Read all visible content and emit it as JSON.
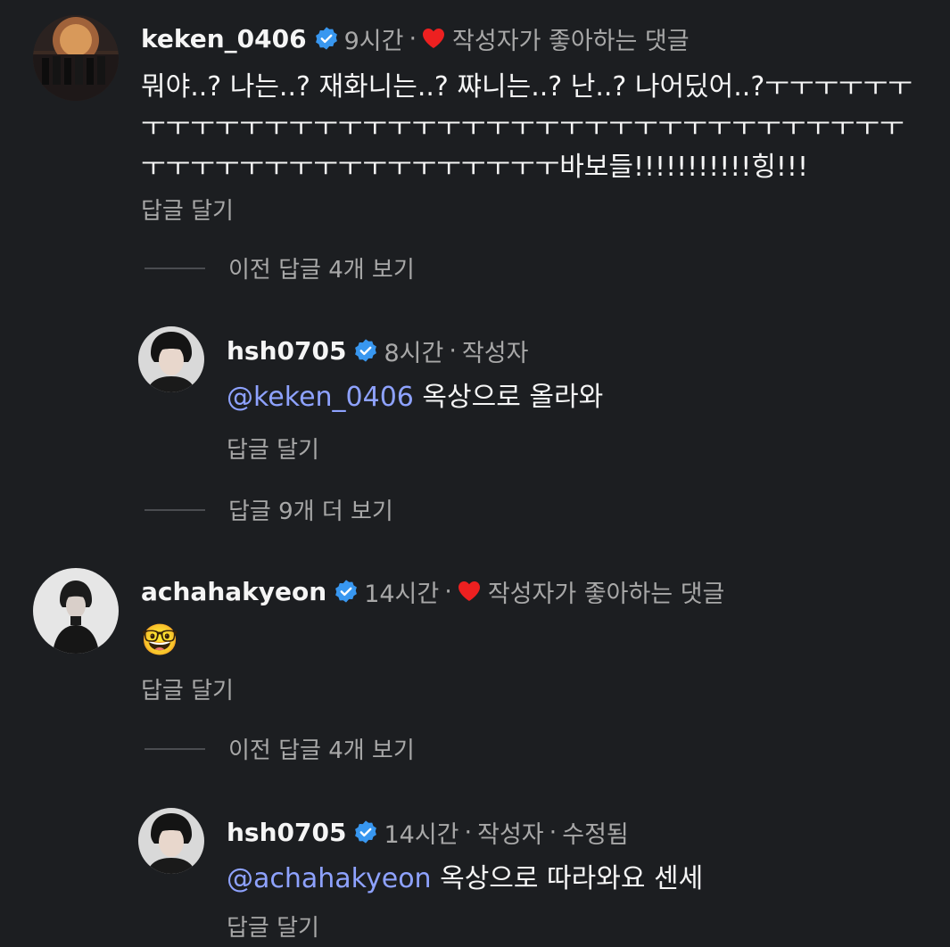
{
  "comments": [
    {
      "username": "keken_0406",
      "time": "9시간",
      "liked_by_author_label": "작성자가 좋아하는 댓글",
      "text": "뭐야..? 나는..? 재화니는..? 쨔니는..? 난..? 나어딨어..?ㅜㅜㅜㅜㅜㅜㅜㅜㅜㅜㅜㅜㅜㅜㅜㅜㅜㅜㅜㅜㅜㅜㅜㅜㅜㅜㅜㅜㅜㅜㅜㅜㅜㅜㅜㅜㅜㅜㅜㅜㅜㅜㅜㅜㅜㅜㅜㅜㅜㅜㅜㅜㅜㅜ바보들!!!!!!!!!!!힝!!!",
      "reply_label": "답글 달기",
      "view_replies_label": "이전 답글 4개 보기",
      "reply": {
        "username": "hsh0705",
        "time": "8시간",
        "author_label": "작성자",
        "mention": "@keken_0406",
        "text": " 옥상으로 올라와",
        "reply_label": "답글 달기"
      },
      "more_replies_label": "답글 9개 더 보기"
    },
    {
      "username": "achahakyeon",
      "time": "14시간",
      "liked_by_author_label": "작성자가 좋아하는 댓글",
      "text": "🤓",
      "reply_label": "답글 달기",
      "view_replies_label": "이전 답글 4개 보기",
      "reply": {
        "username": "hsh0705",
        "time": "14시간",
        "author_label": "작성자",
        "edited_label": "수정됨",
        "mention": "@achahakyeon",
        "text": " 옥상으로 따라와요 센세",
        "reply_label": "답글 달기"
      }
    }
  ],
  "separator": "·",
  "colors": {
    "background": "#1c1e21",
    "verified_badge": "#3897f0",
    "heart": "#ed2020",
    "mention": "#8ea2ff",
    "secondary_text": "#a8a8a8"
  }
}
